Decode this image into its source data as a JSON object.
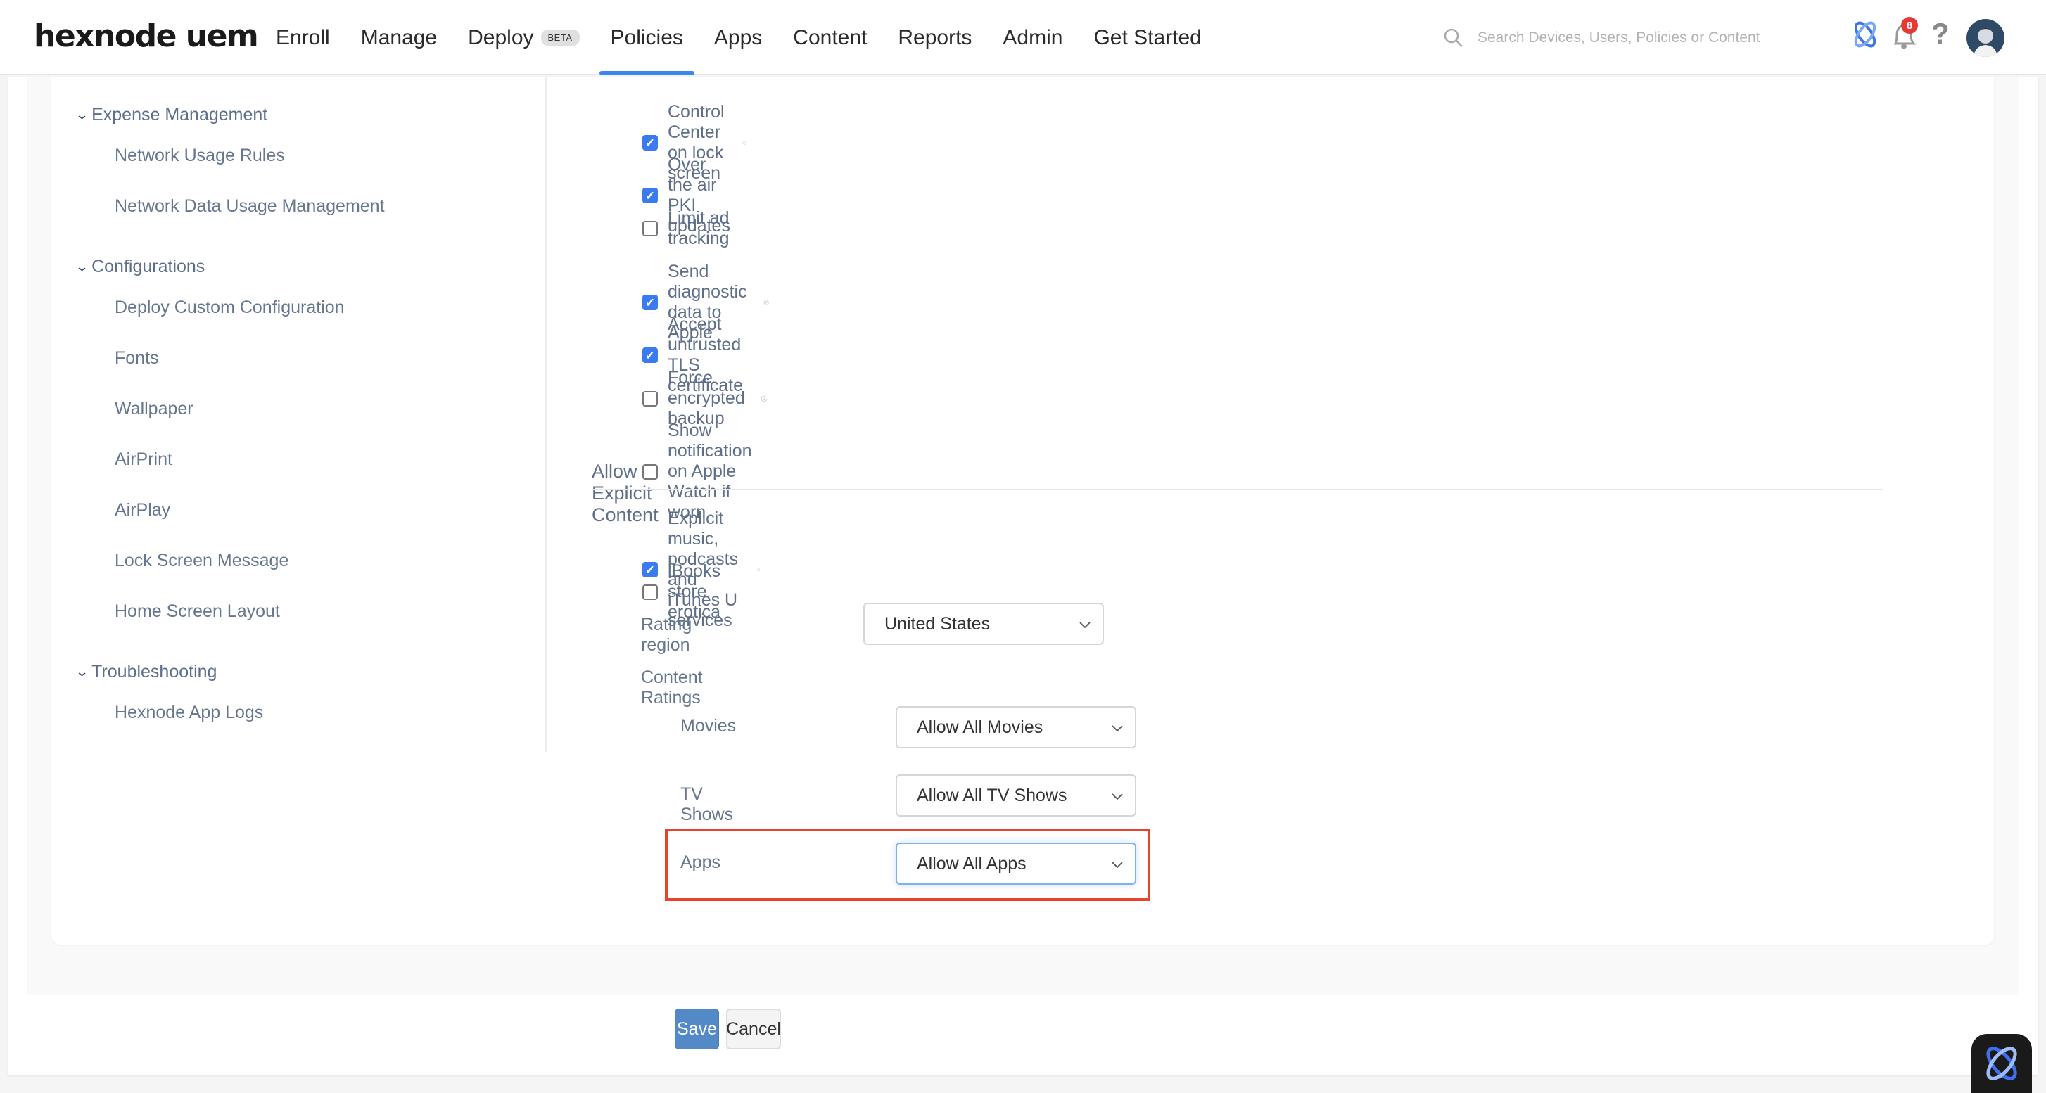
{
  "header": {
    "logo": "hexnode uem",
    "nav": [
      {
        "label": "Enroll"
      },
      {
        "label": "Manage"
      },
      {
        "label": "Deploy",
        "badge": "BETA"
      },
      {
        "label": "Policies",
        "active": true
      },
      {
        "label": "Apps"
      },
      {
        "label": "Content"
      },
      {
        "label": "Reports"
      },
      {
        "label": "Admin"
      },
      {
        "label": "Get Started"
      }
    ],
    "search_placeholder": "Search Devices, Users, Policies or Content",
    "notification_count": "8",
    "help_glyph": "?",
    "accent_color": "#3b86f0"
  },
  "sidebar": {
    "groups": [
      {
        "label": "Expense Management",
        "items": [
          "Network Usage Rules",
          "Network Data Usage Management"
        ]
      },
      {
        "label": "Configurations",
        "items": [
          "Deploy Custom Configuration",
          "Fonts",
          "Wallpaper",
          "AirPrint",
          "AirPlay",
          "Lock Screen Message",
          "Home Screen Layout"
        ]
      },
      {
        "label": "Troubleshooting",
        "items": [
          "Hexnode App Logs"
        ]
      }
    ]
  },
  "settings": [
    {
      "label": "Control Center on lock screen",
      "checked": true,
      "verified": true
    },
    {
      "label": "Over the air PKI updates",
      "checked": true,
      "verified": false
    },
    {
      "label": "Limit ad tracking",
      "checked": false,
      "verified": false
    },
    {
      "label": "Send diagnostic data to Apple",
      "checked": true,
      "verified": true
    },
    {
      "label": "Accept untrusted TLS certificate",
      "checked": true,
      "verified": false
    },
    {
      "label": "Force encrypted backup",
      "checked": false,
      "verified": true
    },
    {
      "label": "Show notification on Apple Watch if worn",
      "checked": false,
      "verified": false
    }
  ],
  "explicit": {
    "title": "Allow Explicit Content",
    "items": [
      {
        "label": "Explicit music, podcasts and iTunes U services",
        "checked": true,
        "verified": true
      },
      {
        "label": "iBooks store erotica",
        "checked": false,
        "verified": false
      }
    ],
    "rating_region_label": "Rating region",
    "rating_region_value": "United States",
    "content_ratings_label": "Content Ratings",
    "movies_label": "Movies",
    "movies_value": "Allow All Movies",
    "tv_label": "TV Shows",
    "tv_value": "Allow All TV Shows",
    "apps_label": "Apps",
    "apps_value": "Allow All Apps"
  },
  "actions": {
    "save": "Save",
    "cancel": "Cancel"
  }
}
